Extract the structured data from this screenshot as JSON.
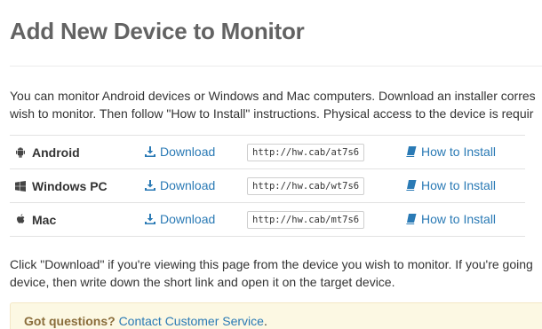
{
  "page": {
    "title": "Add New Device to Monitor",
    "intro_line1": "You can monitor Android devices or Windows and Mac computers. Download an installer corres",
    "intro_line2": "wish to monitor. Then follow \"How to Install\" instructions. Physical access to the device is requir",
    "footer_line1": "Click \"Download\" if you're viewing this page from the device you wish to monitor. If you're going",
    "footer_line2": "device, then write down the short link and open it on the target device."
  },
  "devices": [
    {
      "name": "Android",
      "icon": "android-icon",
      "download_label": "Download",
      "short_link": "http://hw.cab/at7s6",
      "install_label": "How to Install"
    },
    {
      "name": "Windows PC",
      "icon": "windows-icon",
      "download_label": "Download",
      "short_link": "http://hw.cab/wt7s6",
      "install_label": "How to Install"
    },
    {
      "name": "Mac",
      "icon": "apple-icon",
      "download_label": "Download",
      "short_link": "http://hw.cab/mt7s6",
      "install_label": "How to Install"
    }
  ],
  "help": {
    "question": "Got questions?",
    "link_label": "Contact Customer Service",
    "link_suffix": "."
  },
  "colors": {
    "title": "#636363",
    "link": "#2a7ab5",
    "alert_bg": "#fcf8e3",
    "alert_text": "#8a6d3b"
  }
}
